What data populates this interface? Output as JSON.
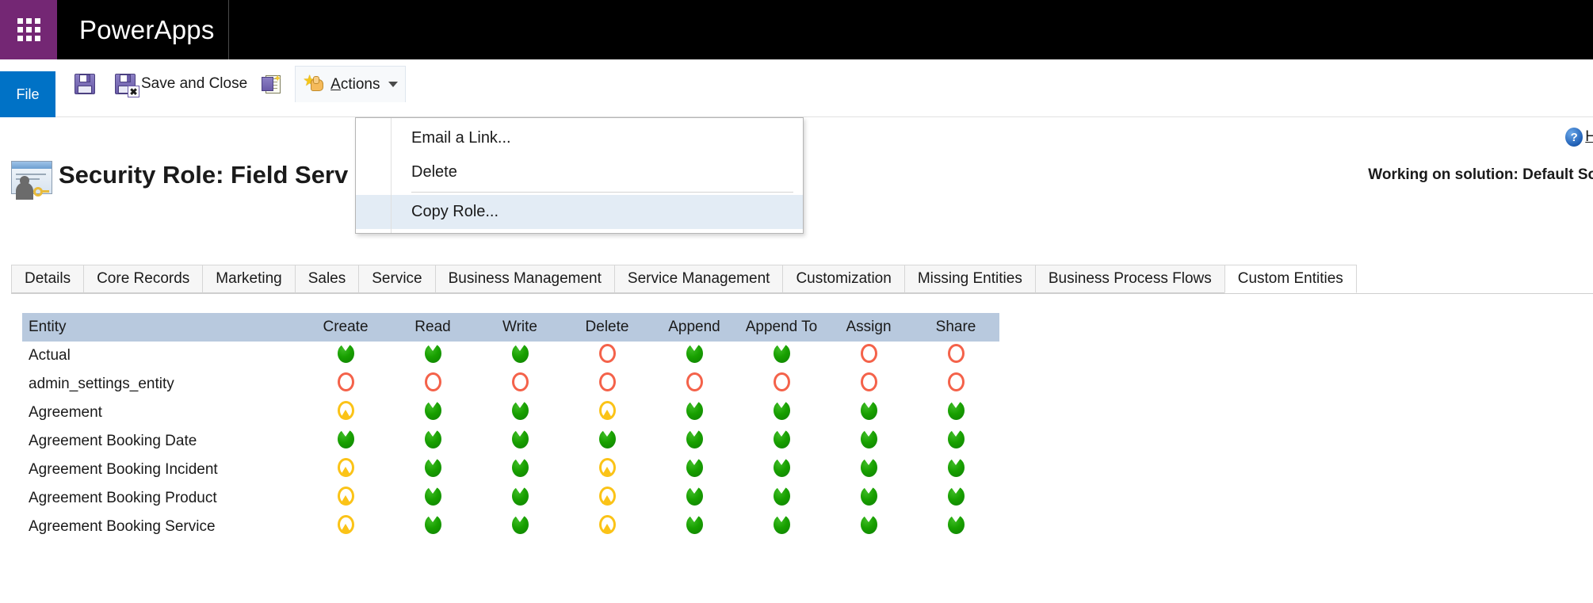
{
  "topbar": {
    "waffle_icon": "app-launcher-waffle-icon",
    "brand": "PowerApps"
  },
  "ribbon": {
    "file_tab": "File",
    "buttons": [
      {
        "name": "save",
        "label": "",
        "icon": "save-floppy-icon"
      },
      {
        "name": "save-and-close",
        "label": "Save and Close",
        "icon": "save-and-close-icon"
      },
      {
        "name": "save-as",
        "label": "",
        "icon": "save-as-new-icon"
      },
      {
        "name": "actions",
        "label": "Actions",
        "icon": "actions-star-hand-icon",
        "has_caret": true,
        "accesskey": "A"
      }
    ],
    "help": {
      "label": "H",
      "icon": "help-question-icon"
    }
  },
  "actions_menu": {
    "items": [
      {
        "label": "Email a Link...",
        "selected": false,
        "separator_after": false
      },
      {
        "label": "Delete",
        "selected": false,
        "separator_after": true
      },
      {
        "label": "Copy Role...",
        "selected": true,
        "separator_after": false
      }
    ]
  },
  "page": {
    "title": "Security Role: Field Serv",
    "title_icon": "security-role-icon",
    "solution_note": "Working on solution: Default Solu"
  },
  "tabs": [
    {
      "label": "Details",
      "active": false
    },
    {
      "label": "Core Records",
      "active": false
    },
    {
      "label": "Marketing",
      "active": false
    },
    {
      "label": "Sales",
      "active": false
    },
    {
      "label": "Service",
      "active": false
    },
    {
      "label": "Business Management",
      "active": false
    },
    {
      "label": "Service Management",
      "active": false
    },
    {
      "label": "Customization",
      "active": false
    },
    {
      "label": "Missing Entities",
      "active": false
    },
    {
      "label": "Business Process Flows",
      "active": false
    },
    {
      "label": "Custom Entities",
      "active": true
    }
  ],
  "grid": {
    "columns": [
      "Entity",
      "Create",
      "Read",
      "Write",
      "Delete",
      "Append",
      "Append To",
      "Assign",
      "Share"
    ],
    "legend": {
      "full": "privilege-full-green-icon",
      "partial": "privilege-partial-yellow-icon",
      "none": "privilege-none-red-icon"
    },
    "rows": [
      {
        "entity": "Actual",
        "privileges": [
          "full",
          "full",
          "full",
          "none",
          "full",
          "full",
          "none",
          "none"
        ]
      },
      {
        "entity": "admin_settings_entity",
        "privileges": [
          "none",
          "none",
          "none",
          "none",
          "none",
          "none",
          "none",
          "none"
        ]
      },
      {
        "entity": "Agreement",
        "privileges": [
          "partial",
          "full",
          "full",
          "partial",
          "full",
          "full",
          "full",
          "full"
        ]
      },
      {
        "entity": "Agreement Booking Date",
        "privileges": [
          "full",
          "full",
          "full",
          "full",
          "full",
          "full",
          "full",
          "full"
        ]
      },
      {
        "entity": "Agreement Booking Incident",
        "privileges": [
          "partial",
          "full",
          "full",
          "partial",
          "full",
          "full",
          "full",
          "full"
        ]
      },
      {
        "entity": "Agreement Booking Product",
        "privileges": [
          "partial",
          "full",
          "full",
          "partial",
          "full",
          "full",
          "full",
          "full"
        ]
      },
      {
        "entity": "Agreement Booking Service",
        "privileges": [
          "partial",
          "full",
          "full",
          "partial",
          "full",
          "full",
          "full",
          "full"
        ]
      }
    ]
  },
  "colors": {
    "brand_purple": "#742774",
    "file_blue": "#0072c6",
    "header_blue_gray": "#b8c9de",
    "privilege_green": "#18a000",
    "privilege_yellow": "#fbc317",
    "privilege_red": "#f4624a",
    "menu_selected": "#e3ecf5"
  }
}
